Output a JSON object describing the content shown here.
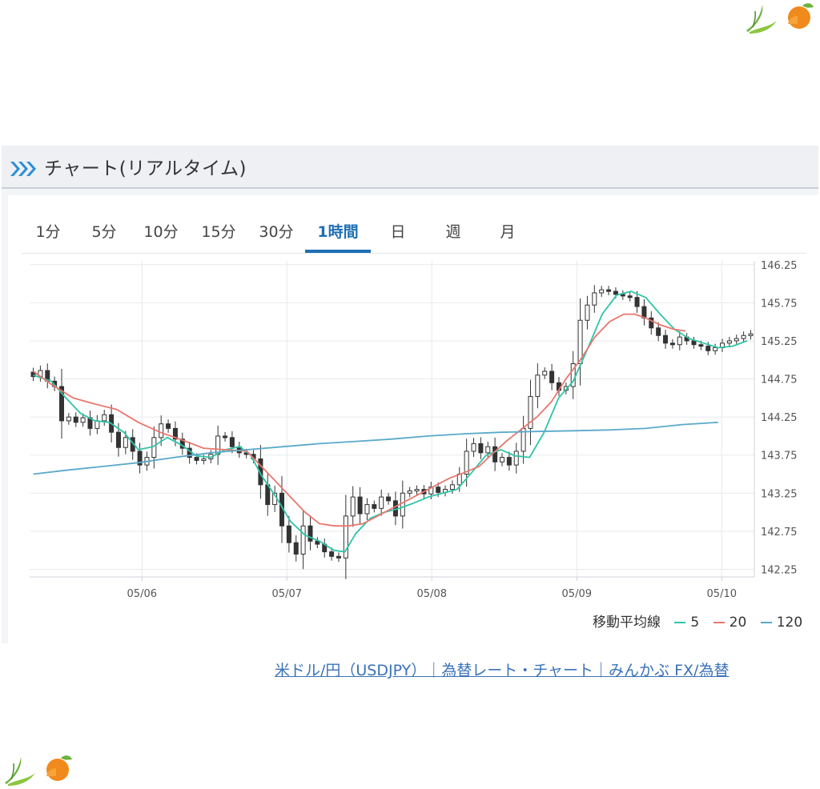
{
  "header": {
    "title": "チャート(リアルタイム)"
  },
  "tabs": [
    {
      "label": "1分",
      "active": false
    },
    {
      "label": "5分",
      "active": false
    },
    {
      "label": "10分",
      "active": false
    },
    {
      "label": "15分",
      "active": false
    },
    {
      "label": "30分",
      "active": false
    },
    {
      "label": "1時間",
      "active": true
    },
    {
      "label": "日",
      "active": false
    },
    {
      "label": "週",
      "active": false
    },
    {
      "label": "月",
      "active": false
    }
  ],
  "legend": {
    "label": "移動平均線",
    "items": [
      {
        "name": "5",
        "color": "#2ec4a6"
      },
      {
        "name": "20",
        "color": "#e8776e"
      },
      {
        "name": "120",
        "color": "#5aa9c9"
      }
    ]
  },
  "source_link": "米ドル/円（USDJPY）｜為替レート・チャート｜みんかぶ FX/為替",
  "colors": {
    "accent": "#1e6fb5",
    "candle": "#333333",
    "ma5": "#2ec4a6",
    "ma20": "#e8776e",
    "ma120": "#5aa9c9"
  },
  "chart_data": {
    "type": "line",
    "ylim": [
      142.15,
      146.3
    ],
    "yticks": [
      "142.25",
      "142.75",
      "143.25",
      "143.75",
      "144.25",
      "144.75",
      "145.25",
      "145.75",
      "146.25"
    ],
    "yticks_values": [
      142.25,
      142.75,
      143.25,
      143.75,
      144.25,
      144.75,
      145.25,
      145.75,
      146.25
    ],
    "x_range": [
      0,
      100
    ],
    "xticks": [
      {
        "x": 15.5,
        "label": "05/06"
      },
      {
        "x": 35.5,
        "label": "05/07"
      },
      {
        "x": 55.5,
        "label": "05/08"
      },
      {
        "x": 75.5,
        "label": "05/09"
      },
      {
        "x": 95.5,
        "label": "05/10"
      }
    ],
    "grid": true,
    "legend_position": "bottom-right",
    "candles_close": [
      144.78,
      144.86,
      144.72,
      144.65,
      144.2,
      144.25,
      144.18,
      144.24,
      144.1,
      144.2,
      144.28,
      144.05,
      143.85,
      143.98,
      143.8,
      143.62,
      143.72,
      143.98,
      144.16,
      144.1,
      143.96,
      143.84,
      143.72,
      143.68,
      143.7,
      143.76,
      144.0,
      143.98,
      143.86,
      143.78,
      143.76,
      143.7,
      143.36,
      143.1,
      143.25,
      142.82,
      142.6,
      142.45,
      142.82,
      142.62,
      142.58,
      142.48,
      142.42,
      142.4,
      142.95,
      143.2,
      142.98,
      143.1,
      143.05,
      143.2,
      143.15,
      142.95,
      143.25,
      143.28,
      143.3,
      143.24,
      143.33,
      143.26,
      143.3,
      143.36,
      143.5,
      143.8,
      143.9,
      143.78,
      143.86,
      143.66,
      143.72,
      143.62,
      143.8,
      144.1,
      144.52,
      144.8,
      144.85,
      144.7,
      144.6,
      144.65,
      144.95,
      145.52,
      145.72,
      145.88,
      145.92,
      145.9,
      145.86,
      145.84,
      145.82,
      145.7,
      145.55,
      145.42,
      145.32,
      145.22,
      145.2,
      145.3,
      145.25,
      145.2,
      145.18,
      145.12,
      145.16,
      145.22,
      145.25,
      145.28,
      145.32,
      145.34
    ],
    "series": [
      {
        "name": "5",
        "color": "#2ec4a6",
        "points": [
          [
            0.5,
            144.8
          ],
          [
            3,
            144.72
          ],
          [
            5,
            144.5
          ],
          [
            7,
            144.3
          ],
          [
            9,
            144.2
          ],
          [
            11,
            144.18
          ],
          [
            13,
            144.05
          ],
          [
            15,
            143.82
          ],
          [
            17,
            143.86
          ],
          [
            19,
            143.98
          ],
          [
            21,
            143.88
          ],
          [
            23,
            143.74
          ],
          [
            25,
            143.72
          ],
          [
            27,
            143.82
          ],
          [
            29,
            143.86
          ],
          [
            30.5,
            143.75
          ],
          [
            32,
            143.48
          ],
          [
            34,
            143.2
          ],
          [
            36,
            142.88
          ],
          [
            38,
            142.7
          ],
          [
            40,
            142.62
          ],
          [
            42,
            142.5
          ],
          [
            43.5,
            142.48
          ],
          [
            45,
            142.72
          ],
          [
            47,
            142.92
          ],
          [
            49,
            143.0
          ],
          [
            51,
            143.05
          ],
          [
            53,
            143.12
          ],
          [
            55,
            143.2
          ],
          [
            57,
            143.25
          ],
          [
            59,
            143.3
          ],
          [
            61,
            143.52
          ],
          [
            63,
            143.75
          ],
          [
            65,
            143.82
          ],
          [
            67,
            143.74
          ],
          [
            69,
            143.72
          ],
          [
            71,
            144.05
          ],
          [
            73,
            144.5
          ],
          [
            75,
            144.72
          ],
          [
            77,
            145.15
          ],
          [
            79,
            145.6
          ],
          [
            81,
            145.85
          ],
          [
            83,
            145.9
          ],
          [
            85,
            145.82
          ],
          [
            87,
            145.6
          ],
          [
            89,
            145.4
          ],
          [
            91,
            145.28
          ],
          [
            93,
            145.22
          ],
          [
            95,
            145.16
          ],
          [
            97,
            145.18
          ],
          [
            99,
            145.25
          ]
        ]
      },
      {
        "name": "20",
        "color": "#e8776e",
        "points": [
          [
            0.5,
            144.85
          ],
          [
            3,
            144.68
          ],
          [
            6,
            144.5
          ],
          [
            9,
            144.42
          ],
          [
            12,
            144.35
          ],
          [
            15,
            144.18
          ],
          [
            18,
            144.05
          ],
          [
            21,
            143.95
          ],
          [
            24,
            143.84
          ],
          [
            27,
            143.82
          ],
          [
            30,
            143.8
          ],
          [
            32,
            143.6
          ],
          [
            34,
            143.4
          ],
          [
            36,
            143.2
          ],
          [
            38,
            143.0
          ],
          [
            40,
            142.85
          ],
          [
            42,
            142.82
          ],
          [
            44,
            142.82
          ],
          [
            46,
            142.85
          ],
          [
            48,
            142.95
          ],
          [
            50,
            143.05
          ],
          [
            52,
            143.15
          ],
          [
            54,
            143.25
          ],
          [
            56,
            143.35
          ],
          [
            58,
            143.45
          ],
          [
            60,
            143.52
          ],
          [
            62,
            143.6
          ],
          [
            64,
            143.78
          ],
          [
            66,
            143.95
          ],
          [
            68,
            144.1
          ],
          [
            70,
            144.25
          ],
          [
            72,
            144.45
          ],
          [
            74,
            144.75
          ],
          [
            76,
            145.0
          ],
          [
            78,
            145.3
          ],
          [
            80,
            145.5
          ],
          [
            82,
            145.6
          ],
          [
            83.5,
            145.6
          ],
          [
            85,
            145.55
          ],
          [
            87,
            145.46
          ],
          [
            89,
            145.4
          ],
          [
            90.5,
            145.38
          ]
        ]
      },
      {
        "name": "120",
        "color": "#5aa9c9",
        "points": [
          [
            0.5,
            143.5
          ],
          [
            5,
            143.55
          ],
          [
            10,
            143.6
          ],
          [
            15,
            143.65
          ],
          [
            20,
            143.72
          ],
          [
            25,
            143.78
          ],
          [
            30,
            143.82
          ],
          [
            35,
            143.86
          ],
          [
            40,
            143.9
          ],
          [
            45,
            143.93
          ],
          [
            50,
            143.96
          ],
          [
            55,
            144.0
          ],
          [
            60,
            144.03
          ],
          [
            65,
            144.05
          ],
          [
            70,
            144.06
          ],
          [
            75,
            144.07
          ],
          [
            80,
            144.08
          ],
          [
            85,
            144.1
          ],
          [
            90,
            144.15
          ],
          [
            95,
            144.18
          ]
        ]
      }
    ]
  }
}
